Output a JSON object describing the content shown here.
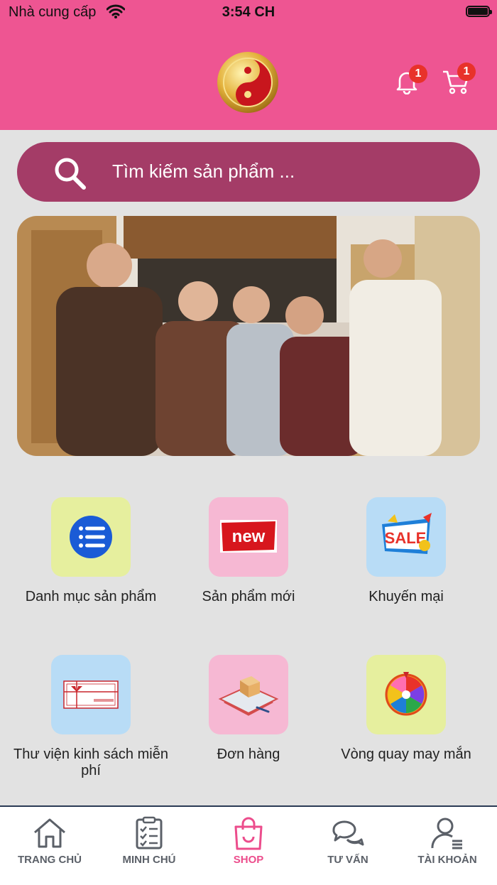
{
  "status_bar": {
    "carrier": "Nhà cung cấp",
    "time": "3:54 CH"
  },
  "header": {
    "notification_badge": "1",
    "cart_badge": "1",
    "brand_color": "#ee5592"
  },
  "search": {
    "placeholder": "Tìm kiếm sản phẩm ..."
  },
  "menu_tiles": [
    {
      "label": "Danh mục sản phẩm",
      "icon": "list-icon"
    },
    {
      "label": "Sản phẩm mới",
      "icon": "new-icon"
    },
    {
      "label": "Khuyến mại",
      "icon": "sale-icon"
    },
    {
      "label": "Thư viện kinh sách miễn phí",
      "icon": "voucher-icon"
    },
    {
      "label": "Đơn hàng",
      "icon": "order-box-icon"
    },
    {
      "label": "Vòng quay may mắn",
      "icon": "lucky-wheel-icon"
    }
  ],
  "tabbar": {
    "items": [
      {
        "label": "TRANG CHỦ",
        "icon": "home-icon"
      },
      {
        "label": "MINH CHÚ",
        "icon": "checklist-icon"
      },
      {
        "label": "SHOP",
        "icon": "shopping-bag-icon",
        "active": true
      },
      {
        "label": "TƯ VẤN",
        "icon": "chat-icon"
      },
      {
        "label": "TÀI KHOẢN",
        "icon": "account-icon"
      }
    ],
    "active_color": "#ec4d8c"
  }
}
